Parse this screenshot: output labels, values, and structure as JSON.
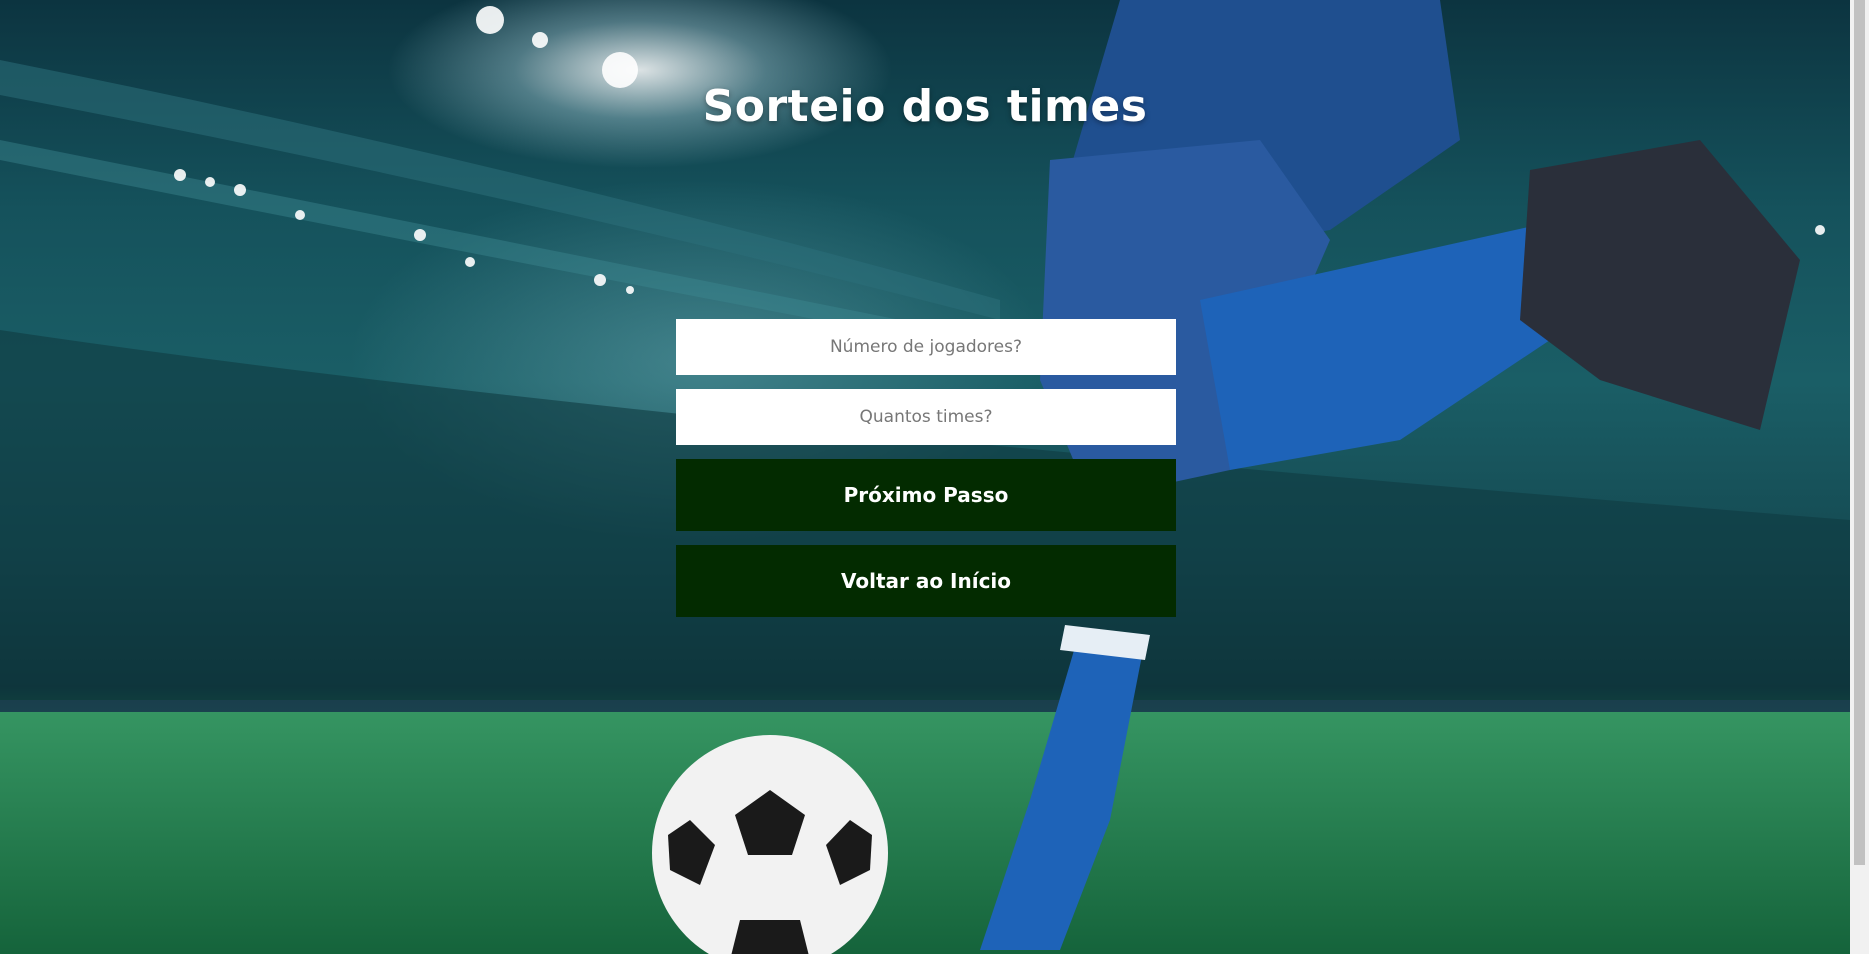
{
  "page": {
    "title": "Sorteio dos times"
  },
  "form": {
    "players_placeholder": "Número de jogadores?",
    "players_value": "",
    "teams_placeholder": "Quantos times?",
    "teams_value": "",
    "next_button_label": "Próximo Passo",
    "back_button_label": "Voltar ao Início"
  },
  "colors": {
    "button_bg": "#032b00",
    "button_text": "#ffffff",
    "input_bg": "#ffffff",
    "title_text": "#ffffff"
  },
  "background": {
    "scene": "football-stadium-player-kicking-ball"
  }
}
